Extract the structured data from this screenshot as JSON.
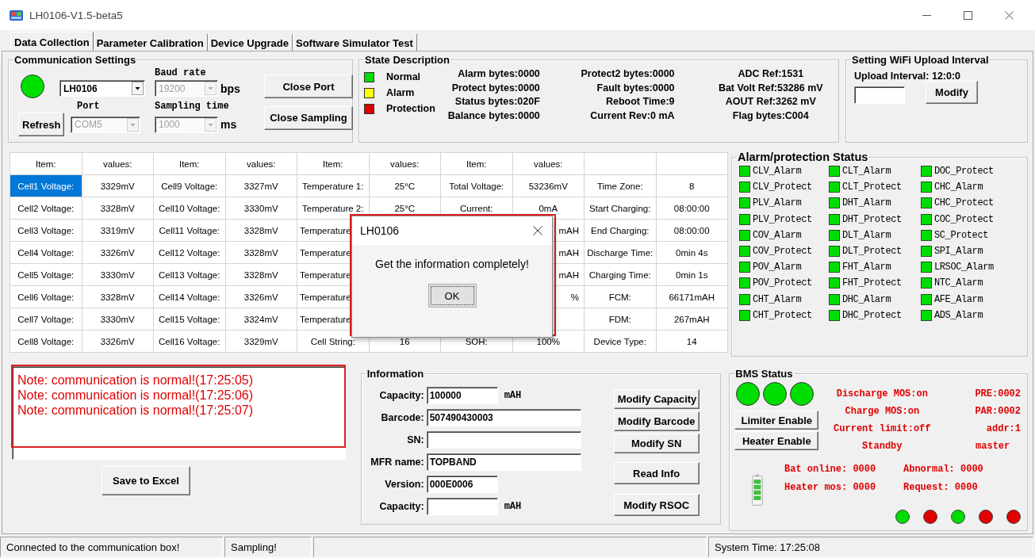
{
  "window": {
    "title": "LH0106-V1.5-beta5"
  },
  "tabs": [
    {
      "label": "Data Collection",
      "selected": true
    },
    {
      "label": "Parameter Calibration",
      "selected": false
    },
    {
      "label": "Device Upgrade",
      "selected": false
    },
    {
      "label": "Software Simulator Test",
      "selected": false
    }
  ],
  "communication": {
    "title": "Communication Settings",
    "connected": true,
    "device": {
      "value": "LH0106",
      "disabled": false
    },
    "baud_label": "Baud rate",
    "baud": {
      "value": "19200",
      "disabled": true
    },
    "baud_unit": "bps",
    "port_label": "Port",
    "port": {
      "value": "COM5",
      "disabled": true
    },
    "sampling_label": "Sampling time",
    "sampling": {
      "value": "1000",
      "disabled": true
    },
    "sampling_unit": "ms",
    "buttons": [
      "Close Port",
      "Close Sampling",
      "Refresh"
    ]
  },
  "state_description": {
    "title": "State Description",
    "legend": [
      {
        "label": "Normal",
        "color": "#00dd00"
      },
      {
        "label": "Alarm",
        "color": "#ffff00"
      },
      {
        "label": "Protection",
        "color": "#e00000"
      }
    ],
    "columns": [
      [
        "Alarm bytes:0000",
        "Protect bytes:0000",
        "Status bytes:020F",
        "Balance bytes:0000"
      ],
      [
        "Protect2 bytes:0000",
        "Fault bytes:0000",
        "Reboot Time:9",
        "Current Rev:0 mA"
      ],
      [
        "ADC Ref:1531",
        "Bat Volt Ref:53286 mV",
        "AOUT Ref:3262 mV",
        "Flag bytes:C004"
      ]
    ]
  },
  "wifi": {
    "title": "Setting WiFi Upload Interval",
    "interval": "Upload Interval: 12:0:0",
    "button": "Modify"
  },
  "table": {
    "columns": [
      "Item:",
      "values:",
      "Item:",
      "values:",
      "Item:",
      "values:",
      "Item:",
      "values:"
    ],
    "rows": [
      {
        "selected": true,
        "cells": [
          "Cell1 Voltage:",
          "3329mV",
          "Cell9 Voltage:",
          "3327mV",
          "Temperature 1:",
          "25°C",
          "Total Voltage:",
          "53236mV",
          "Time Zone:",
          "8"
        ]
      },
      {
        "selected": false,
        "cells": [
          "Cell2 Voltage:",
          "3328mV",
          "Cell10 Voltage:",
          "3330mV",
          "Temperature 2:",
          "25°C",
          "Current:",
          "0mA",
          "Start Charging:",
          "08:00:00"
        ]
      },
      {
        "selected": false,
        "cells": [
          "Cell3 Voltage:",
          "3319mV",
          "Cell11 Voltage:",
          "3328mV",
          "Temperature",
          null,
          null,
          "mAH",
          "End Charging:",
          "08:00:00"
        ]
      },
      {
        "selected": false,
        "cells": [
          "Cell4 Voltage:",
          "3326mV",
          "Cell12 Voltage:",
          "3328mV",
          "Temperature",
          null,
          null,
          "mAH",
          "Discharge Time:",
          "0min 4s"
        ]
      },
      {
        "selected": false,
        "cells": [
          "Cell5 Voltage:",
          "3330mV",
          "Cell13 Voltage:",
          "3328mV",
          "Temperature",
          null,
          null,
          "mAH",
          "Charging Time:",
          "0min 1s"
        ]
      },
      {
        "selected": false,
        "cells": [
          "Cell6 Voltage:",
          "3328mV",
          "Cell14 Voltage:",
          "3326mV",
          "Temperature",
          null,
          null,
          "%",
          "FCM:",
          "66171mAH"
        ]
      },
      {
        "selected": false,
        "cells": [
          "Cell7 Voltage:",
          "3330mV",
          "Cell15 Voltage:",
          "3324mV",
          "Temperature",
          null,
          null,
          null,
          "FDM:",
          "267mAH"
        ]
      },
      {
        "selected": false,
        "cells": [
          "Cell8 Voltage:",
          "3326mV",
          "Cell16 Voltage:",
          "3329mV",
          "Cell String:",
          "16",
          "SOH:",
          "100%",
          "Device Type:",
          "14"
        ]
      }
    ]
  },
  "dialog": {
    "title": "LH0106",
    "message": "Get the information completely!",
    "button": "OK"
  },
  "alarm_status": {
    "title": "Alarm/protection Status",
    "items": [
      {
        "label": "CLV_Alarm",
        "color": "#00dd00"
      },
      {
        "label": "CLT_Alarm",
        "color": "#00dd00"
      },
      {
        "label": "DOC_Protect",
        "color": "#00dd00"
      },
      {
        "label": "CLV_Protect",
        "color": "#00dd00"
      },
      {
        "label": "CLT_Protect",
        "color": "#00dd00"
      },
      {
        "label": "CHC_Alarm",
        "color": "#00dd00"
      },
      {
        "label": "PLV_Alarm",
        "color": "#00dd00"
      },
      {
        "label": "DHT_Alarm",
        "color": "#00dd00"
      },
      {
        "label": "CHC_Protect",
        "color": "#00dd00"
      },
      {
        "label": "PLV_Protect",
        "color": "#00dd00"
      },
      {
        "label": "DHT_Protect",
        "color": "#00dd00"
      },
      {
        "label": "COC_Protect",
        "color": "#00dd00"
      },
      {
        "label": "COV_Alarm",
        "color": "#00dd00"
      },
      {
        "label": "DLT_Alarm",
        "color": "#00dd00"
      },
      {
        "label": "SC_Protect",
        "color": "#00dd00"
      },
      {
        "label": "COV_Protect",
        "color": "#00dd00"
      },
      {
        "label": "DLT_Protect",
        "color": "#00dd00"
      },
      {
        "label": "SPI_Alarm",
        "color": "#00dd00"
      },
      {
        "label": "POV_Alarm",
        "color": "#00dd00"
      },
      {
        "label": "FHT_Alarm",
        "color": "#00dd00"
      },
      {
        "label": "LRSOC_Alarm",
        "color": "#00dd00"
      },
      {
        "label": "POV_Protect",
        "color": "#00dd00"
      },
      {
        "label": "FHT_Protect",
        "color": "#00dd00"
      },
      {
        "label": "NTC_Alarm",
        "color": "#00dd00"
      },
      {
        "label": "CHT_Alarm",
        "color": "#00dd00"
      },
      {
        "label": "DHC_Alarm",
        "color": "#00dd00"
      },
      {
        "label": "AFE_Alarm",
        "color": "#00dd00"
      },
      {
        "label": "CHT_Protect",
        "color": "#00dd00"
      },
      {
        "label": "DHC_Protect",
        "color": "#00dd00"
      },
      {
        "label": "ADS_Alarm",
        "color": "#00dd00"
      }
    ]
  },
  "log": {
    "lines": [
      "Note: communication is normal!(17:25:05)",
      "Note: communication is normal!(17:25:06)",
      "Note: communication is normal!(17:25:07)"
    ],
    "button": "Save to Excel"
  },
  "information": {
    "title": "Information",
    "fields": [
      {
        "label": "Capacity:",
        "value": "100000",
        "unit": "mAH",
        "kind": "short"
      },
      {
        "label": "Barcode:",
        "value": "507490430003",
        "kind": "wide"
      },
      {
        "label": "SN:",
        "kind": "wide"
      },
      {
        "label": "MFR name:",
        "value": "TOPBAND",
        "kind": "wide"
      },
      {
        "label": "Version:",
        "value": "000E0006",
        "kind": "short"
      },
      {
        "label": "Capacity:",
        "unit": "mAH",
        "kind": "short"
      }
    ],
    "buttons": [
      "Modify Capacity",
      "Modify Barcode",
      "Modify SN",
      "Read Info",
      "Modify RSOC"
    ]
  },
  "bms_status": {
    "title": "BMS Status",
    "indicators": [
      {
        "color": "#00dd00"
      },
      {
        "color": "#00dd00"
      },
      {
        "color": "#00dd00"
      }
    ],
    "buttons": [
      "Limiter Enable",
      "Heater Enable"
    ],
    "states": [
      "Discharge MOS:on",
      "Charge MOS:on",
      "Current limit:off",
      "Standby"
    ],
    "side": [
      "PRE:0002",
      "PAR:0002",
      "addr:1",
      "master"
    ],
    "counters": [
      "Bat online: 0000",
      "Abnormal: 0000",
      "Heater mos: 0000",
      "Request: 0000"
    ],
    "dots": [
      {
        "color": "#00dd00"
      },
      {
        "color": "#e00000"
      },
      {
        "color": "#00dd00"
      },
      {
        "color": "#e00000"
      },
      {
        "color": "#e00000"
      }
    ]
  },
  "status_bar": [
    "Connected to the communication box!",
    "Sampling!",
    "System Time: 17:25:08"
  ]
}
